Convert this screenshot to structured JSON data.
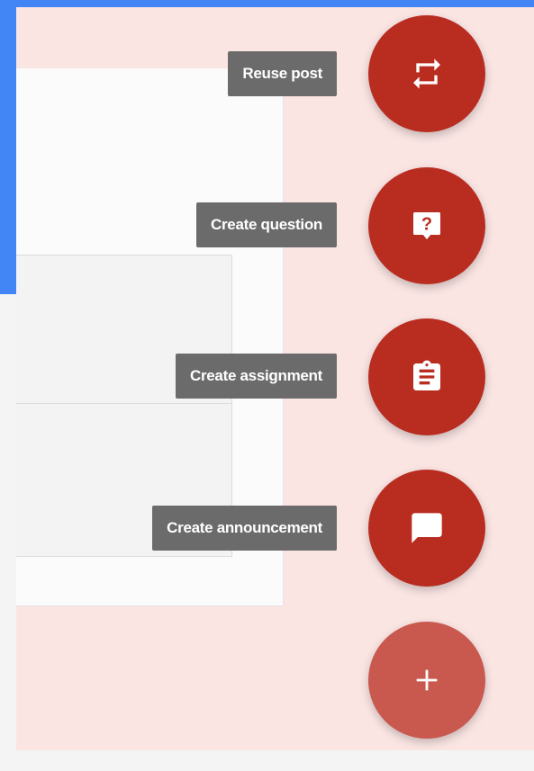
{
  "speed_dial": {
    "actions": [
      {
        "label": "Reuse post",
        "icon": "reuse-icon"
      },
      {
        "label": "Create question",
        "icon": "question-icon"
      },
      {
        "label": "Create assignment",
        "icon": "assignment-icon"
      },
      {
        "label": "Create announcement",
        "icon": "announcement-icon"
      }
    ],
    "main_button": {
      "glyph": "+",
      "icon": "add-icon"
    }
  },
  "colors": {
    "fab": "#b92d21",
    "fab_main": "#c9584e",
    "label_bg": "#6b6b6b",
    "overlay": "#fae5e3",
    "header_blue": "#4285f4"
  }
}
